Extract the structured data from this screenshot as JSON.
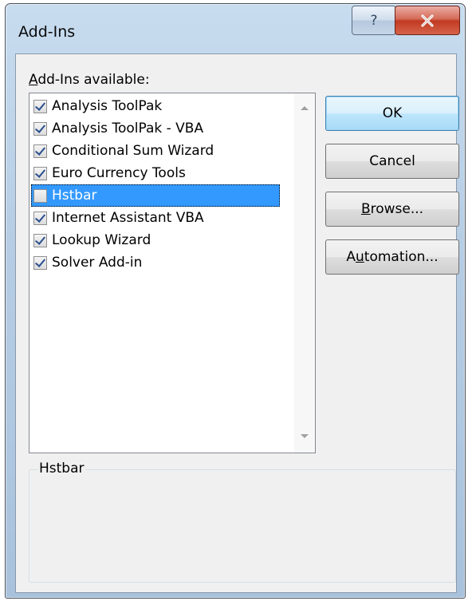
{
  "window": {
    "title": "Add-Ins",
    "help_glyph": "?",
    "close_glyph": "x"
  },
  "list": {
    "label_prefix": "",
    "label_accel": "A",
    "label_rest": "dd-Ins available:",
    "items": [
      {
        "label": "Analysis ToolPak",
        "checked": true
      },
      {
        "label": "Analysis ToolPak - VBA",
        "checked": true
      },
      {
        "label": "Conditional Sum Wizard",
        "checked": true
      },
      {
        "label": "Euro Currency Tools",
        "checked": true
      },
      {
        "label": "Hstbar",
        "checked": false,
        "selected": true
      },
      {
        "label": "Internet Assistant VBA",
        "checked": true
      },
      {
        "label": "Lookup Wizard",
        "checked": true
      },
      {
        "label": "Solver Add-in",
        "checked": true
      }
    ]
  },
  "buttons": {
    "ok": "OK",
    "cancel": "Cancel",
    "browse_accel": "B",
    "browse_rest": "rowse...",
    "automation_pre": "A",
    "automation_accel": "u",
    "automation_rest": "tomation..."
  },
  "description": {
    "title": "Hstbar"
  },
  "colors": {
    "selection": "#3399ff",
    "checkmark": "#2a4f8f",
    "close_button": "#c13a22"
  }
}
